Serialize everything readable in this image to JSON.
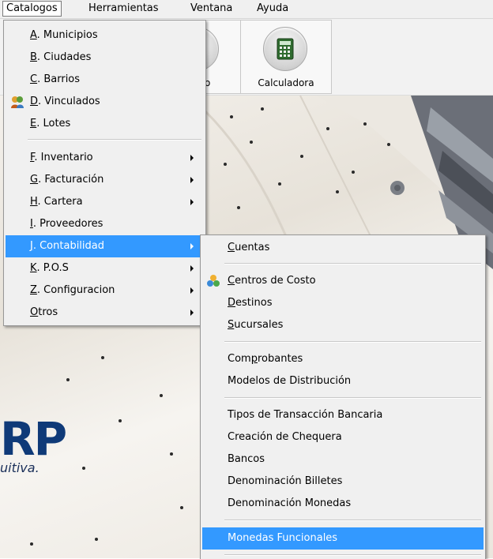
{
  "menubar": {
    "items": [
      "Catalogos",
      "Herramientas",
      "Ventana",
      "Ayuda"
    ]
  },
  "toolbar": {
    "partial_label": "o",
    "calculator_label": "Calculadora"
  },
  "brand": {
    "logo_text": "RP",
    "tagline": "uitiva."
  },
  "catalogos_menu": {
    "items": [
      {
        "key": "A",
        "label": ". Municipios"
      },
      {
        "key": "B",
        "label": ". Ciudades"
      },
      {
        "key": "C",
        "label": ". Barrios"
      },
      {
        "key": "D",
        "label": ". Vinculados"
      },
      {
        "key": "E",
        "label": ". Lotes"
      },
      {
        "key": "F",
        "label": ".  Inventario"
      },
      {
        "key": "G",
        "label": ". Facturación"
      },
      {
        "key": "H",
        "label": ". Cartera"
      },
      {
        "key": "I",
        "label": ".  Proveedores"
      },
      {
        "key": "J",
        "label": ". Contabilidad"
      },
      {
        "key": "K",
        "label": ". P.O.S"
      },
      {
        "key": "Z",
        "label": ". Configuracion"
      },
      {
        "key": "O",
        "label": "tros"
      }
    ]
  },
  "contabilidad_menu": {
    "items": [
      {
        "key": "C",
        "label": "uentas"
      },
      {
        "key": "C",
        "label": "entros de Costo"
      },
      {
        "key": "D",
        "label": "estinos"
      },
      {
        "key": "S",
        "label": "ucursales"
      },
      {
        "pre": "Com",
        "key": "p",
        "label": "robantes"
      },
      {
        "label": "Modelos de Distribución"
      },
      {
        "label": "Tipos de Transacción Bancaria"
      },
      {
        "label": "Creación de Chequera"
      },
      {
        "label": "Bancos"
      },
      {
        "label": "Denominación Billetes"
      },
      {
        "label": "Denominación Monedas"
      },
      {
        "label": "Monedas Funcionales"
      }
    ]
  }
}
